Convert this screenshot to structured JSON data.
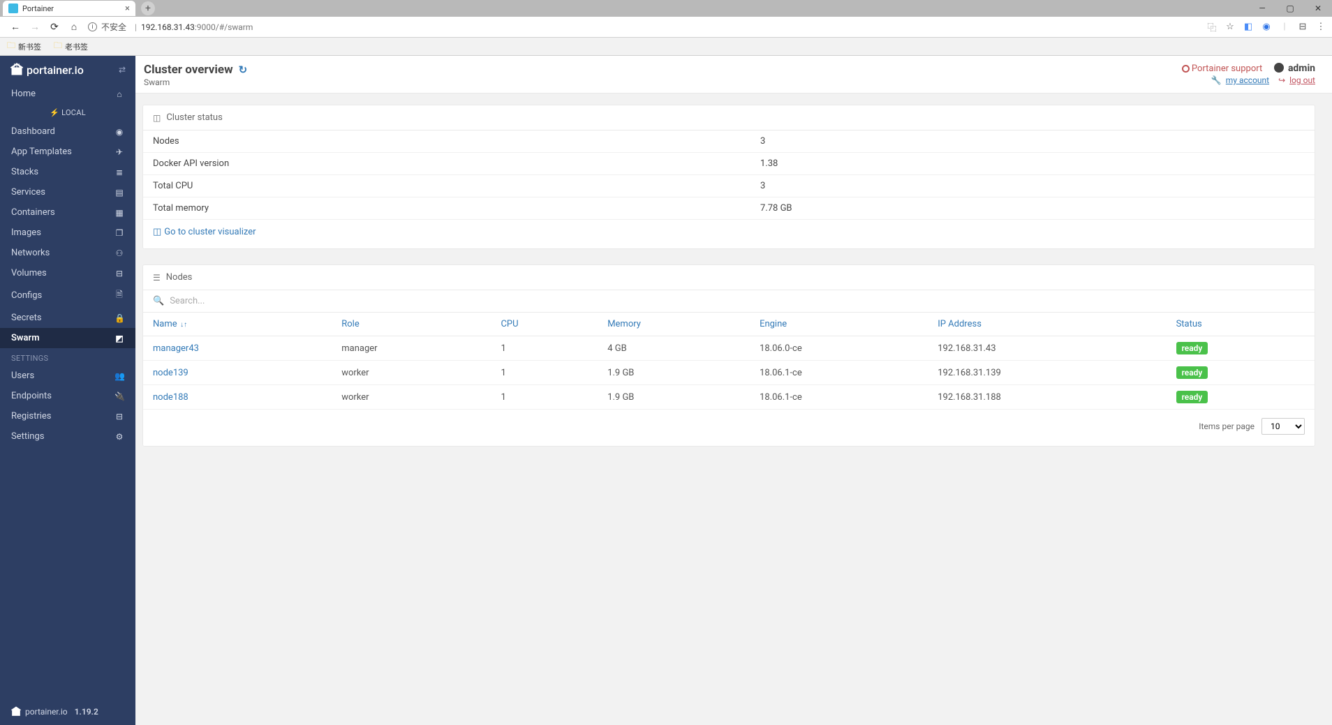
{
  "browser": {
    "tab_title": "Portainer",
    "url_insecure": "不安全",
    "url_host": "192.168.31.43",
    "url_port_path": ":9000/#/swarm",
    "bookmarks": [
      "新书签",
      "老书签"
    ]
  },
  "sidebar": {
    "logo": "portainer.io",
    "group": "LOCAL",
    "items": [
      {
        "label": "Home",
        "icon": "home"
      },
      {
        "label": "Dashboard",
        "icon": "dashboard"
      },
      {
        "label": "App Templates",
        "icon": "templates"
      },
      {
        "label": "Stacks",
        "icon": "stacks"
      },
      {
        "label": "Services",
        "icon": "services"
      },
      {
        "label": "Containers",
        "icon": "containers"
      },
      {
        "label": "Images",
        "icon": "images"
      },
      {
        "label": "Networks",
        "icon": "networks"
      },
      {
        "label": "Volumes",
        "icon": "volumes"
      },
      {
        "label": "Configs",
        "icon": "configs"
      },
      {
        "label": "Secrets",
        "icon": "secrets"
      },
      {
        "label": "Swarm",
        "icon": "swarm"
      }
    ],
    "settings_header": "SETTINGS",
    "settings": [
      {
        "label": "Users",
        "icon": "users"
      },
      {
        "label": "Endpoints",
        "icon": "endpoints"
      },
      {
        "label": "Registries",
        "icon": "registries"
      },
      {
        "label": "Settings",
        "icon": "settings"
      }
    ],
    "footer_brand": "portainer.io",
    "footer_version": "1.19.2"
  },
  "header": {
    "title": "Cluster overview",
    "breadcrumb": "Swarm",
    "support": "Portainer support",
    "user": "admin",
    "my_account": "my account",
    "log_out": "log out"
  },
  "status_card": {
    "title": "Cluster status",
    "rows": [
      {
        "label": "Nodes",
        "value": "3"
      },
      {
        "label": "Docker API version",
        "value": "1.38"
      },
      {
        "label": "Total CPU",
        "value": "3"
      },
      {
        "label": "Total memory",
        "value": "7.78 GB"
      }
    ],
    "visualizer_link": "Go to cluster visualizer"
  },
  "nodes_card": {
    "title": "Nodes",
    "search_placeholder": "Search...",
    "columns": [
      "Name",
      "Role",
      "CPU",
      "Memory",
      "Engine",
      "IP Address",
      "Status"
    ],
    "rows": [
      {
        "name": "manager43",
        "role": "manager",
        "cpu": "1",
        "memory": "4 GB",
        "engine": "18.06.0-ce",
        "ip": "192.168.31.43",
        "status": "ready"
      },
      {
        "name": "node139",
        "role": "worker",
        "cpu": "1",
        "memory": "1.9 GB",
        "engine": "18.06.1-ce",
        "ip": "192.168.31.139",
        "status": "ready"
      },
      {
        "name": "node188",
        "role": "worker",
        "cpu": "1",
        "memory": "1.9 GB",
        "engine": "18.06.1-ce",
        "ip": "192.168.31.188",
        "status": "ready"
      }
    ],
    "footer_label": "Items per page",
    "per_page": "10"
  }
}
